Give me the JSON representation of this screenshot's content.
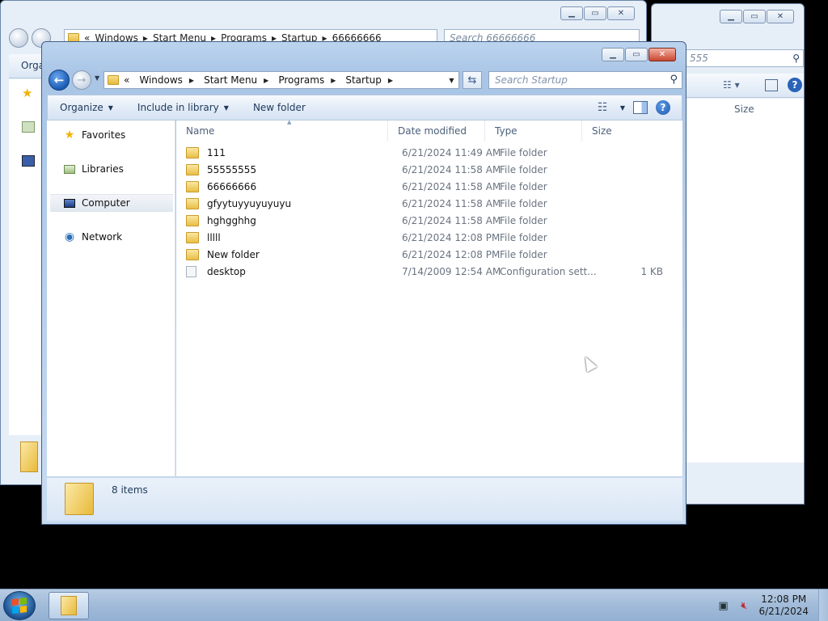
{
  "background_windows": {
    "back_window_1": {
      "breadcrumb": [
        "Windows",
        "Start Menu",
        "Programs",
        "Startup",
        "66666666"
      ],
      "search_placeholder": "Search 66666666",
      "organize_fragment": "Orga"
    },
    "back_window_2": {
      "search_fragment": "555",
      "size_header": "Size"
    }
  },
  "window": {
    "breadcrumb_chevron": "«",
    "breadcrumb": [
      "Windows",
      "Start Menu",
      "Programs",
      "Startup"
    ],
    "search_placeholder": "Search Startup",
    "toolbar": {
      "organize": "Organize",
      "include_in_library": "Include in library",
      "new_folder": "New folder"
    },
    "nav": {
      "favorites": "Favorites",
      "libraries": "Libraries",
      "computer": "Computer",
      "network": "Network"
    },
    "columns": {
      "name": "Name",
      "date_modified": "Date modified",
      "type": "Type",
      "size": "Size"
    },
    "files": [
      {
        "name": "111",
        "date": "6/21/2024 11:49 AM",
        "type": "File folder",
        "size": "",
        "icon": "folder"
      },
      {
        "name": "55555555",
        "date": "6/21/2024 11:58 AM",
        "type": "File folder",
        "size": "",
        "icon": "folder"
      },
      {
        "name": "66666666",
        "date": "6/21/2024 11:58 AM",
        "type": "File folder",
        "size": "",
        "icon": "folder"
      },
      {
        "name": "gfyytuyyuyuyuyu",
        "date": "6/21/2024 11:58 AM",
        "type": "File folder",
        "size": "",
        "icon": "folder"
      },
      {
        "name": "hghgghhg",
        "date": "6/21/2024 11:58 AM",
        "type": "File folder",
        "size": "",
        "icon": "folder"
      },
      {
        "name": "lllll",
        "date": "6/21/2024 12:08 PM",
        "type": "File folder",
        "size": "",
        "icon": "folder"
      },
      {
        "name": "New folder",
        "date": "6/21/2024 12:08 PM",
        "type": "File folder",
        "size": "",
        "icon": "folder"
      },
      {
        "name": "desktop",
        "date": "7/14/2009 12:54 AM",
        "type": "Configuration sett...",
        "size": "1 KB",
        "icon": "config-file"
      }
    ],
    "status": {
      "item_count": "8 items"
    }
  },
  "taskbar": {
    "time": "12:08 PM",
    "date": "6/21/2024"
  }
}
